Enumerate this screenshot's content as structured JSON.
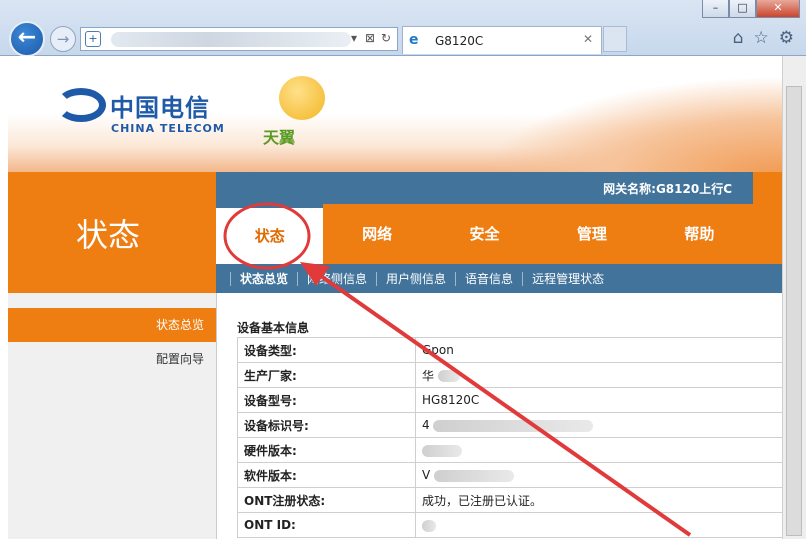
{
  "browser": {
    "tab_title": "G8120C",
    "icons": [
      "back-arrow-icon",
      "forward-arrow-icon",
      "shield-icon",
      "refresh-icon",
      "home-icon",
      "star-icon",
      "gear-icon"
    ]
  },
  "header": {
    "logo_cn": "中国电信",
    "logo_en": "CHINA TELECOM",
    "sub_logo": "天翼"
  },
  "gateway": {
    "label": "网关名称:G8120上行C"
  },
  "left_title": "状态",
  "main_nav": [
    "状态",
    "网络",
    "安全",
    "管理",
    "帮助"
  ],
  "sub_nav": [
    "状态总览",
    "网络侧信息",
    "用户侧信息",
    "语音信息",
    "远程管理状态"
  ],
  "side_menu": [
    "状态总览",
    "配置向导"
  ],
  "section_title": "设备基本信息",
  "rows": [
    {
      "key": "设备类型:",
      "value": "Gpon"
    },
    {
      "key": "生产厂家:",
      "value": "华"
    },
    {
      "key": "设备型号:",
      "value": "HG8120C"
    },
    {
      "key": "设备标识号:",
      "value": "4"
    },
    {
      "key": "硬件版本:",
      "value": ""
    },
    {
      "key": "软件版本:",
      "value": "V"
    },
    {
      "key": "ONT注册状态:",
      "value": "成功，已注册已认证。"
    },
    {
      "key": "ONT ID:",
      "value": ""
    }
  ],
  "colors": {
    "orange": "#ef7e12",
    "steel_blue": "#41739b",
    "annotation_red": "#e03a3a"
  }
}
